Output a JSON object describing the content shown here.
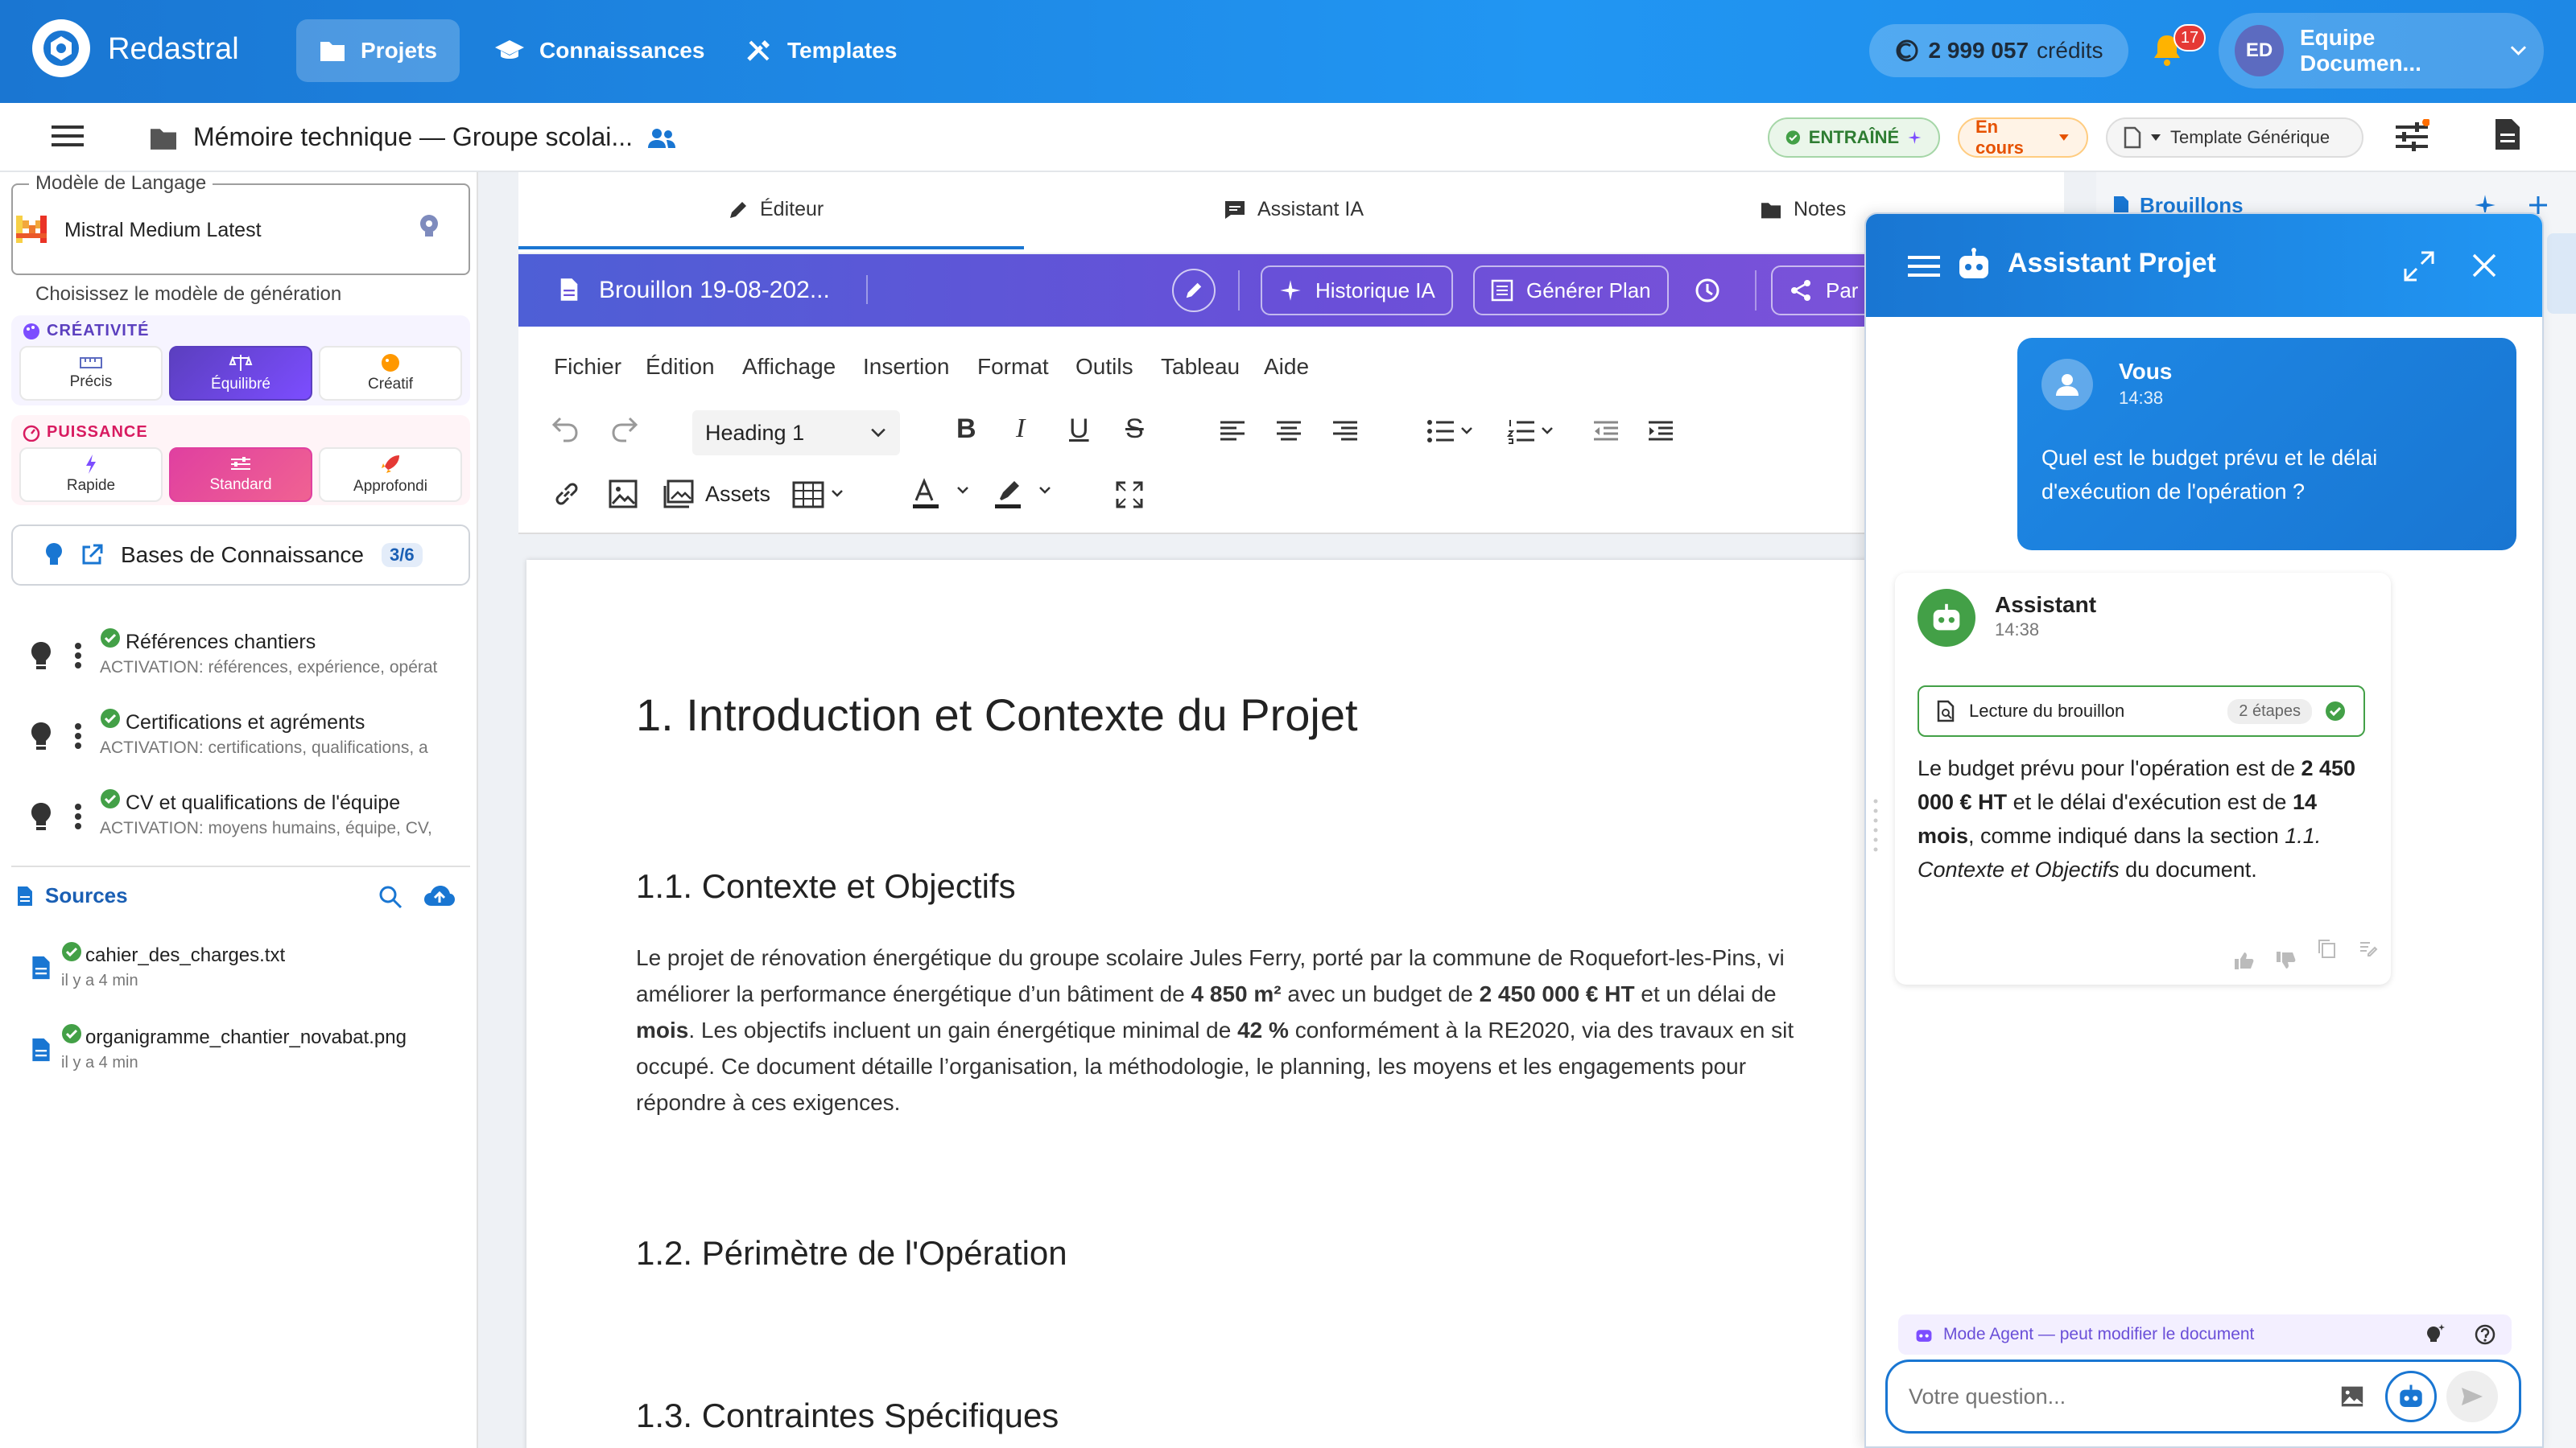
{
  "app": {
    "brand": "Redastral"
  },
  "nav": [
    {
      "label": "Projets",
      "icon": "folder-icon",
      "active": true
    },
    {
      "label": "Connaissances",
      "icon": "graduation-cap-icon"
    },
    {
      "label": "Templates",
      "icon": "tools-icon"
    }
  ],
  "credits": {
    "value": "2 999 057",
    "unit": "crédits"
  },
  "notifications": {
    "count": "17"
  },
  "user": {
    "initials": "ED",
    "name": "Equipe Documen..."
  },
  "document": {
    "title": "Mémoire technique — Groupe scolai..."
  },
  "status": {
    "trained": "ENTRAÎNÉ",
    "progress": "En cours",
    "template": "Template Générique"
  },
  "left": {
    "model_label": "Modèle de Langage",
    "model_name": "Mistral Medium Latest",
    "hint": "Choisissez le modèle de génération",
    "creativity": {
      "title": "CRÉATIVITÉ",
      "options": [
        "Précis",
        "Équilibré",
        "Créatif"
      ],
      "selected": "Équilibré"
    },
    "power": {
      "title": "PUISSANCE",
      "options": [
        "Rapide",
        "Standard",
        "Approfondi"
      ],
      "selected": "Standard"
    },
    "kb": {
      "label": "Bases de Connaissance",
      "count": "3/6"
    },
    "kb_items": [
      {
        "title": "Références chantiers",
        "sub": "ACTIVATION: références, expérience, opérat"
      },
      {
        "title": "Certifications et agréments",
        "sub": "ACTIVATION: certifications, qualifications, a"
      },
      {
        "title": "CV et qualifications de l'équipe",
        "sub": "ACTIVATION: moyens humains, équipe, CV,"
      }
    ],
    "sources_label": "Sources",
    "sources": [
      {
        "name": "cahier_des_charges.txt",
        "time": "il y a 4 min"
      },
      {
        "name": "organigramme_chantier_novabat.png",
        "time": "il y a 4 min"
      }
    ]
  },
  "tabs": [
    {
      "label": "Éditeur",
      "icon": "pencil-icon",
      "active": true
    },
    {
      "label": "Assistant IA",
      "icon": "chat-icon"
    },
    {
      "label": "Notes",
      "icon": "folder-icon"
    }
  ],
  "draft": {
    "title": "Brouillon 19-08-202...",
    "history_btn": "Historique IA",
    "plan_btn": "Générer Plan",
    "share_btn": "Par"
  },
  "side_panel": {
    "title": "Brouillons"
  },
  "editor_menu": [
    "Fichier",
    "Édition",
    "Affichage",
    "Insertion",
    "Format",
    "Outils",
    "Tableau",
    "Aide"
  ],
  "editor_toolbar": {
    "block_style": "Heading 1",
    "assets": "Assets"
  },
  "content": {
    "h1": "1. Introduction et Contexte du Projet",
    "h2_1": "1.1. Contexte et Objectifs",
    "para": [
      {
        "t": "Le projet de rénovation énergétique du groupe scolaire Jules Ferry, porté par la commune de Roquefort-les-Pins, vi"
      },
      {
        "t": " améliorer la performance énergétique d’un bâtiment de ",
        "br": true
      },
      {
        "t": "4 850 m²",
        "b": true
      },
      {
        "t": " avec un budget de "
      },
      {
        "t": "2 450 000 € HT",
        "b": true
      },
      {
        "t": " et un délai de"
      },
      {
        "t": "mois",
        "b": true,
        "br": true
      },
      {
        "t": ". Les objectifs incluent un gain énergétique minimal de "
      },
      {
        "t": "42 %",
        "b": true
      },
      {
        "t": " conformément à la RE2020, via des travaux en sit"
      },
      {
        "t": "occupé. Ce document détaille l’organisation, la méthodologie, le planning, les moyens et les engagements pour",
        "br": true
      },
      {
        "t": "répondre à ces exigences.",
        "br": true
      }
    ],
    "h2_2": "1.2. Périmètre de l'Opération",
    "h2_3": "1.3. Contraintes Spécifiques"
  },
  "chat": {
    "title": "Assistant Projet",
    "user_msg": {
      "author": "Vous",
      "time": "14:38",
      "text": "Quel est le budget prévu et le délai d'exécution de l'opération ?"
    },
    "ai_msg": {
      "author": "Assistant",
      "time": "14:38",
      "step": "Lecture du brouillon",
      "step_count": "2 étapes",
      "parts": [
        {
          "t": "Le budget prévu pour l'opération est de "
        },
        {
          "t": "2 450 000 € HT",
          "b": true
        },
        {
          "t": " et le délai d'exécution est de "
        },
        {
          "t": "14 mois",
          "b": true
        },
        {
          "t": ", comme indiqué dans la section "
        },
        {
          "t": "1.1. Contexte et Objectifs",
          "i": true
        },
        {
          "t": " du document."
        }
      ]
    },
    "agent_mode": "Mode Agent — peut modifier le document",
    "input_placeholder": "Votre question..."
  },
  "colors": {
    "primary": "#1976d2",
    "purple": "#6a4fd8",
    "pink": "#e040a0",
    "success": "#43a047",
    "warning": "#ff6d00"
  }
}
